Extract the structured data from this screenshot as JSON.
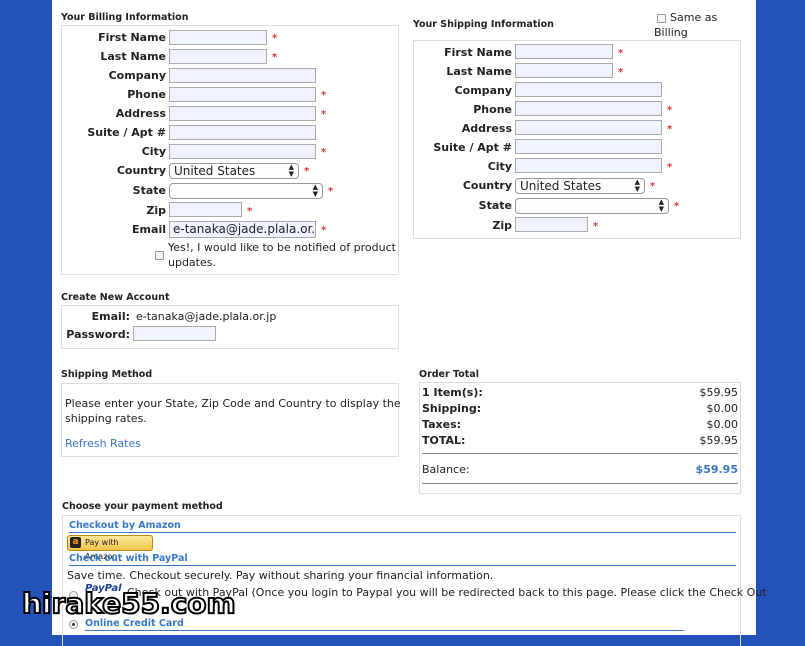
{
  "billing": {
    "title": "Your Billing Information",
    "labels": {
      "first_name": "First Name",
      "last_name": "Last Name",
      "company": "Company",
      "phone": "Phone",
      "address": "Address",
      "suite": "Suite / Apt #",
      "city": "City",
      "country": "Country",
      "state": "State",
      "zip": "Zip",
      "email": "Email"
    },
    "country_value": "United States",
    "email_value": "e-tanaka@jade.plala.or.j",
    "notify_text_1": "Yes!, I would like to be notified of product",
    "notify_text_2": "updates."
  },
  "shipping": {
    "title": "Your Shipping Information",
    "same_as_1": "Same as",
    "same_as_2": "Billing",
    "labels": {
      "first_name": "First Name",
      "last_name": "Last Name",
      "company": "Company",
      "phone": "Phone",
      "address": "Address",
      "suite": "Suite / Apt #",
      "city": "City",
      "country": "Country",
      "state": "State",
      "zip": "Zip"
    },
    "country_value": "United States"
  },
  "account": {
    "title": "Create New Account",
    "email_label": "Email:",
    "email_value": "e-tanaka@jade.plala.or.jp",
    "password_label": "Password:"
  },
  "shipping_method": {
    "title": "Shipping Method",
    "message_1": "Please enter your State, Zip Code and Country to display the",
    "message_2": "shipping rates.",
    "refresh_label": "Refresh Rates"
  },
  "order_total": {
    "title": "Order Total",
    "rows": [
      {
        "label": "1 Item(s):",
        "value": "$59.95"
      },
      {
        "label": "Shipping:",
        "value": "$0.00"
      },
      {
        "label": "Taxes:",
        "value": "$0.00"
      },
      {
        "label": "TOTAL:",
        "value": "$59.95"
      }
    ],
    "balance_label": "Balance:",
    "balance_value": "$59.95"
  },
  "payment": {
    "title": "Choose your payment method",
    "amazon_heading": "Checkout by Amazon",
    "amazon_button": "Pay with Amazon",
    "paypal_heading": "Check out with PayPal",
    "paypal_tagline": "Save time. Checkout securely. Pay without sharing your financial information.",
    "paypal_logo": "PayPal",
    "paypal_text": "Check out with PayPal (Once you login to Paypal you will be redirected back to this page. Please click the Check Out",
    "credit_card_heading": "Online Credit Card"
  },
  "watermark": "hirake55.com",
  "colors": {
    "background": "#2352b8",
    "link": "#3a78c4",
    "required": "#dd3333",
    "input_bg": "#eef3ff"
  }
}
